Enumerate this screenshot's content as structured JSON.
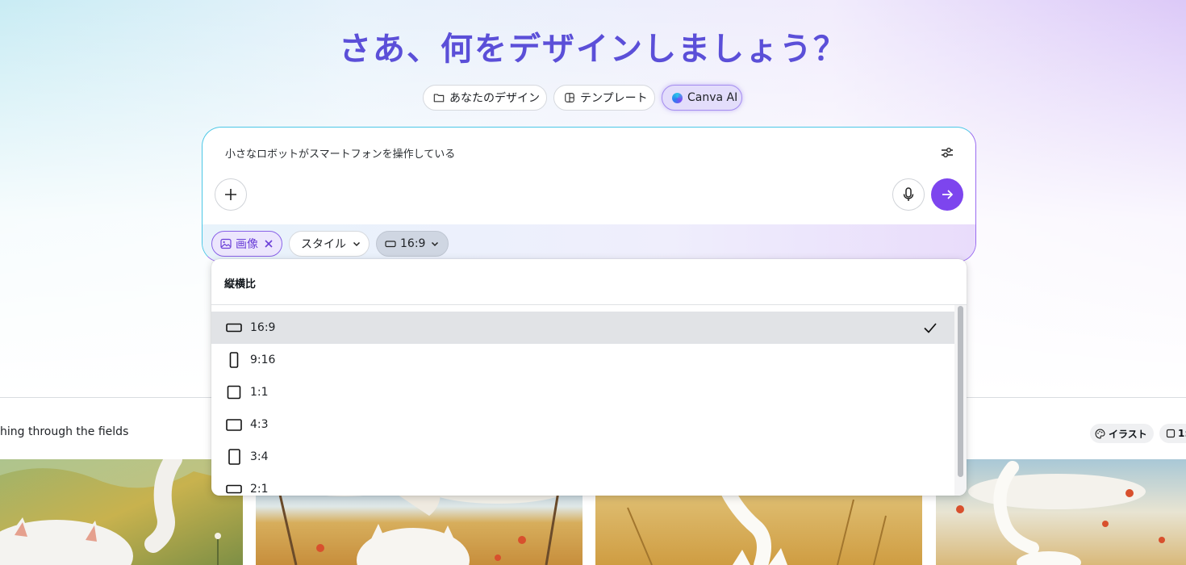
{
  "header": {
    "title": "さあ、何をデザインしましょう？"
  },
  "tabs": [
    {
      "label": "あなたのデザイン",
      "icon": "folder-icon"
    },
    {
      "label": "テンプレート",
      "icon": "template-icon"
    },
    {
      "label": "Canva AI",
      "icon": "canva-ai-icon",
      "active": true
    }
  ],
  "prompt": {
    "text": "小さなロボットがスマートフォンを操作している",
    "chips": {
      "image_label": "画像",
      "style_label": "スタイル",
      "ratio_label": "16:9"
    }
  },
  "ratio_menu": {
    "title": "縦横比",
    "selected": "16:9",
    "options": [
      {
        "label": "16:9",
        "shape": "landscape-wide"
      },
      {
        "label": "9:16",
        "shape": "portrait-tall"
      },
      {
        "label": "1:1",
        "shape": "square"
      },
      {
        "label": "4:3",
        "shape": "landscape"
      },
      {
        "label": "3:4",
        "shape": "portrait"
      },
      {
        "label": "2:1",
        "shape": "landscape-extra-wide"
      }
    ]
  },
  "results": {
    "caption": "hing through the fields",
    "tags": {
      "style": "イラスト",
      "ratio": "1:"
    }
  },
  "colors": {
    "accent": "#7d45ee",
    "title": "#5b4fd8",
    "selected_row": "#e1e3e6"
  }
}
